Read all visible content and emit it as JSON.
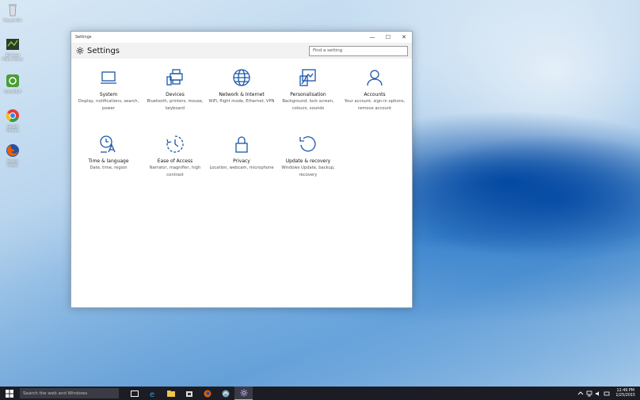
{
  "desktop": {
    "icons": [
      {
        "name": "Recycle Bin",
        "color": "#c9d3dc"
      },
      {
        "name": "3D Vision Photo Viewer",
        "color": "#3b5a2b"
      },
      {
        "name": "GameStuff",
        "color": "#4b9d38"
      },
      {
        "name": "Google Chrome",
        "color": "#e34133"
      },
      {
        "name": "Mozilla Firefox",
        "color": "#e66000"
      }
    ]
  },
  "window": {
    "title": "Settings",
    "controls": {
      "minimize": "—",
      "maximize": "☐",
      "close": "✕"
    },
    "header_title": "Settings",
    "search_placeholder": "Find a setting"
  },
  "tiles": [
    {
      "name": "System",
      "desc": "Display, notifications, search, power",
      "icon": "laptop-icon"
    },
    {
      "name": "Devices",
      "desc": "Bluetooth, printers, mouse, keyboard",
      "icon": "devices-icon"
    },
    {
      "name": "Network & Internet",
      "desc": "WiFi, flight mode, Ethernet, VPN",
      "icon": "globe-icon"
    },
    {
      "name": "Personalisation",
      "desc": "Background, lock screen, colours, sounds",
      "icon": "personalisation-icon"
    },
    {
      "name": "Accounts",
      "desc": "Your account, sign-in options, remove account",
      "icon": "person-icon"
    },
    {
      "name": "Time & language",
      "desc": "Date, time, region",
      "icon": "time-language-icon"
    },
    {
      "name": "Ease of Access",
      "desc": "Narrator, magnifier, high contrast",
      "icon": "ease-of-access-icon"
    },
    {
      "name": "Privacy",
      "desc": "Location, webcam, microphone",
      "icon": "lock-icon"
    },
    {
      "name": "Update & recovery",
      "desc": "Windows Update, backup, recovery",
      "icon": "update-icon"
    }
  ],
  "taskbar": {
    "search_placeholder": "Search the web and Windows",
    "clock_time": "12:49 PM",
    "clock_date": "1/25/2015",
    "accent": "#2d7ad6"
  }
}
